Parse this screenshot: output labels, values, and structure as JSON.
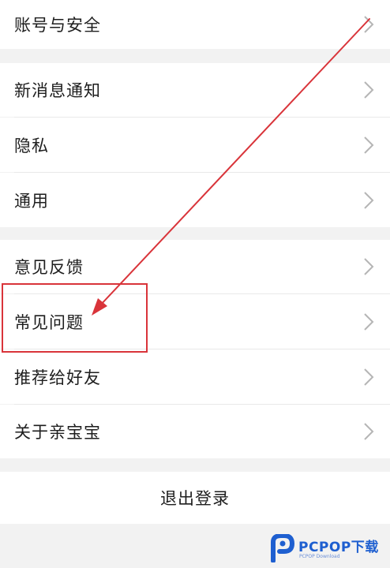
{
  "settings": {
    "groups": [
      {
        "items": [
          {
            "label": "账号与安全"
          }
        ]
      },
      {
        "items": [
          {
            "label": "新消息通知"
          },
          {
            "label": "隐私"
          },
          {
            "label": "通用"
          }
        ]
      },
      {
        "items": [
          {
            "label": "意见反馈"
          },
          {
            "label": "常见问题"
          },
          {
            "label": "推荐给好友"
          },
          {
            "label": "关于亲宝宝"
          }
        ]
      }
    ],
    "logout_label": "退出登录"
  },
  "annotation": {
    "highlighted_item": "常见问题",
    "color": "#d9343a"
  },
  "watermark": {
    "brand": "PCPOP下载",
    "sub": "PCPOP Download",
    "color": "#1e5fd0"
  },
  "icons": {
    "chevron": "chevron-right-icon",
    "watermark_logo": "pcpop-logo-icon"
  }
}
